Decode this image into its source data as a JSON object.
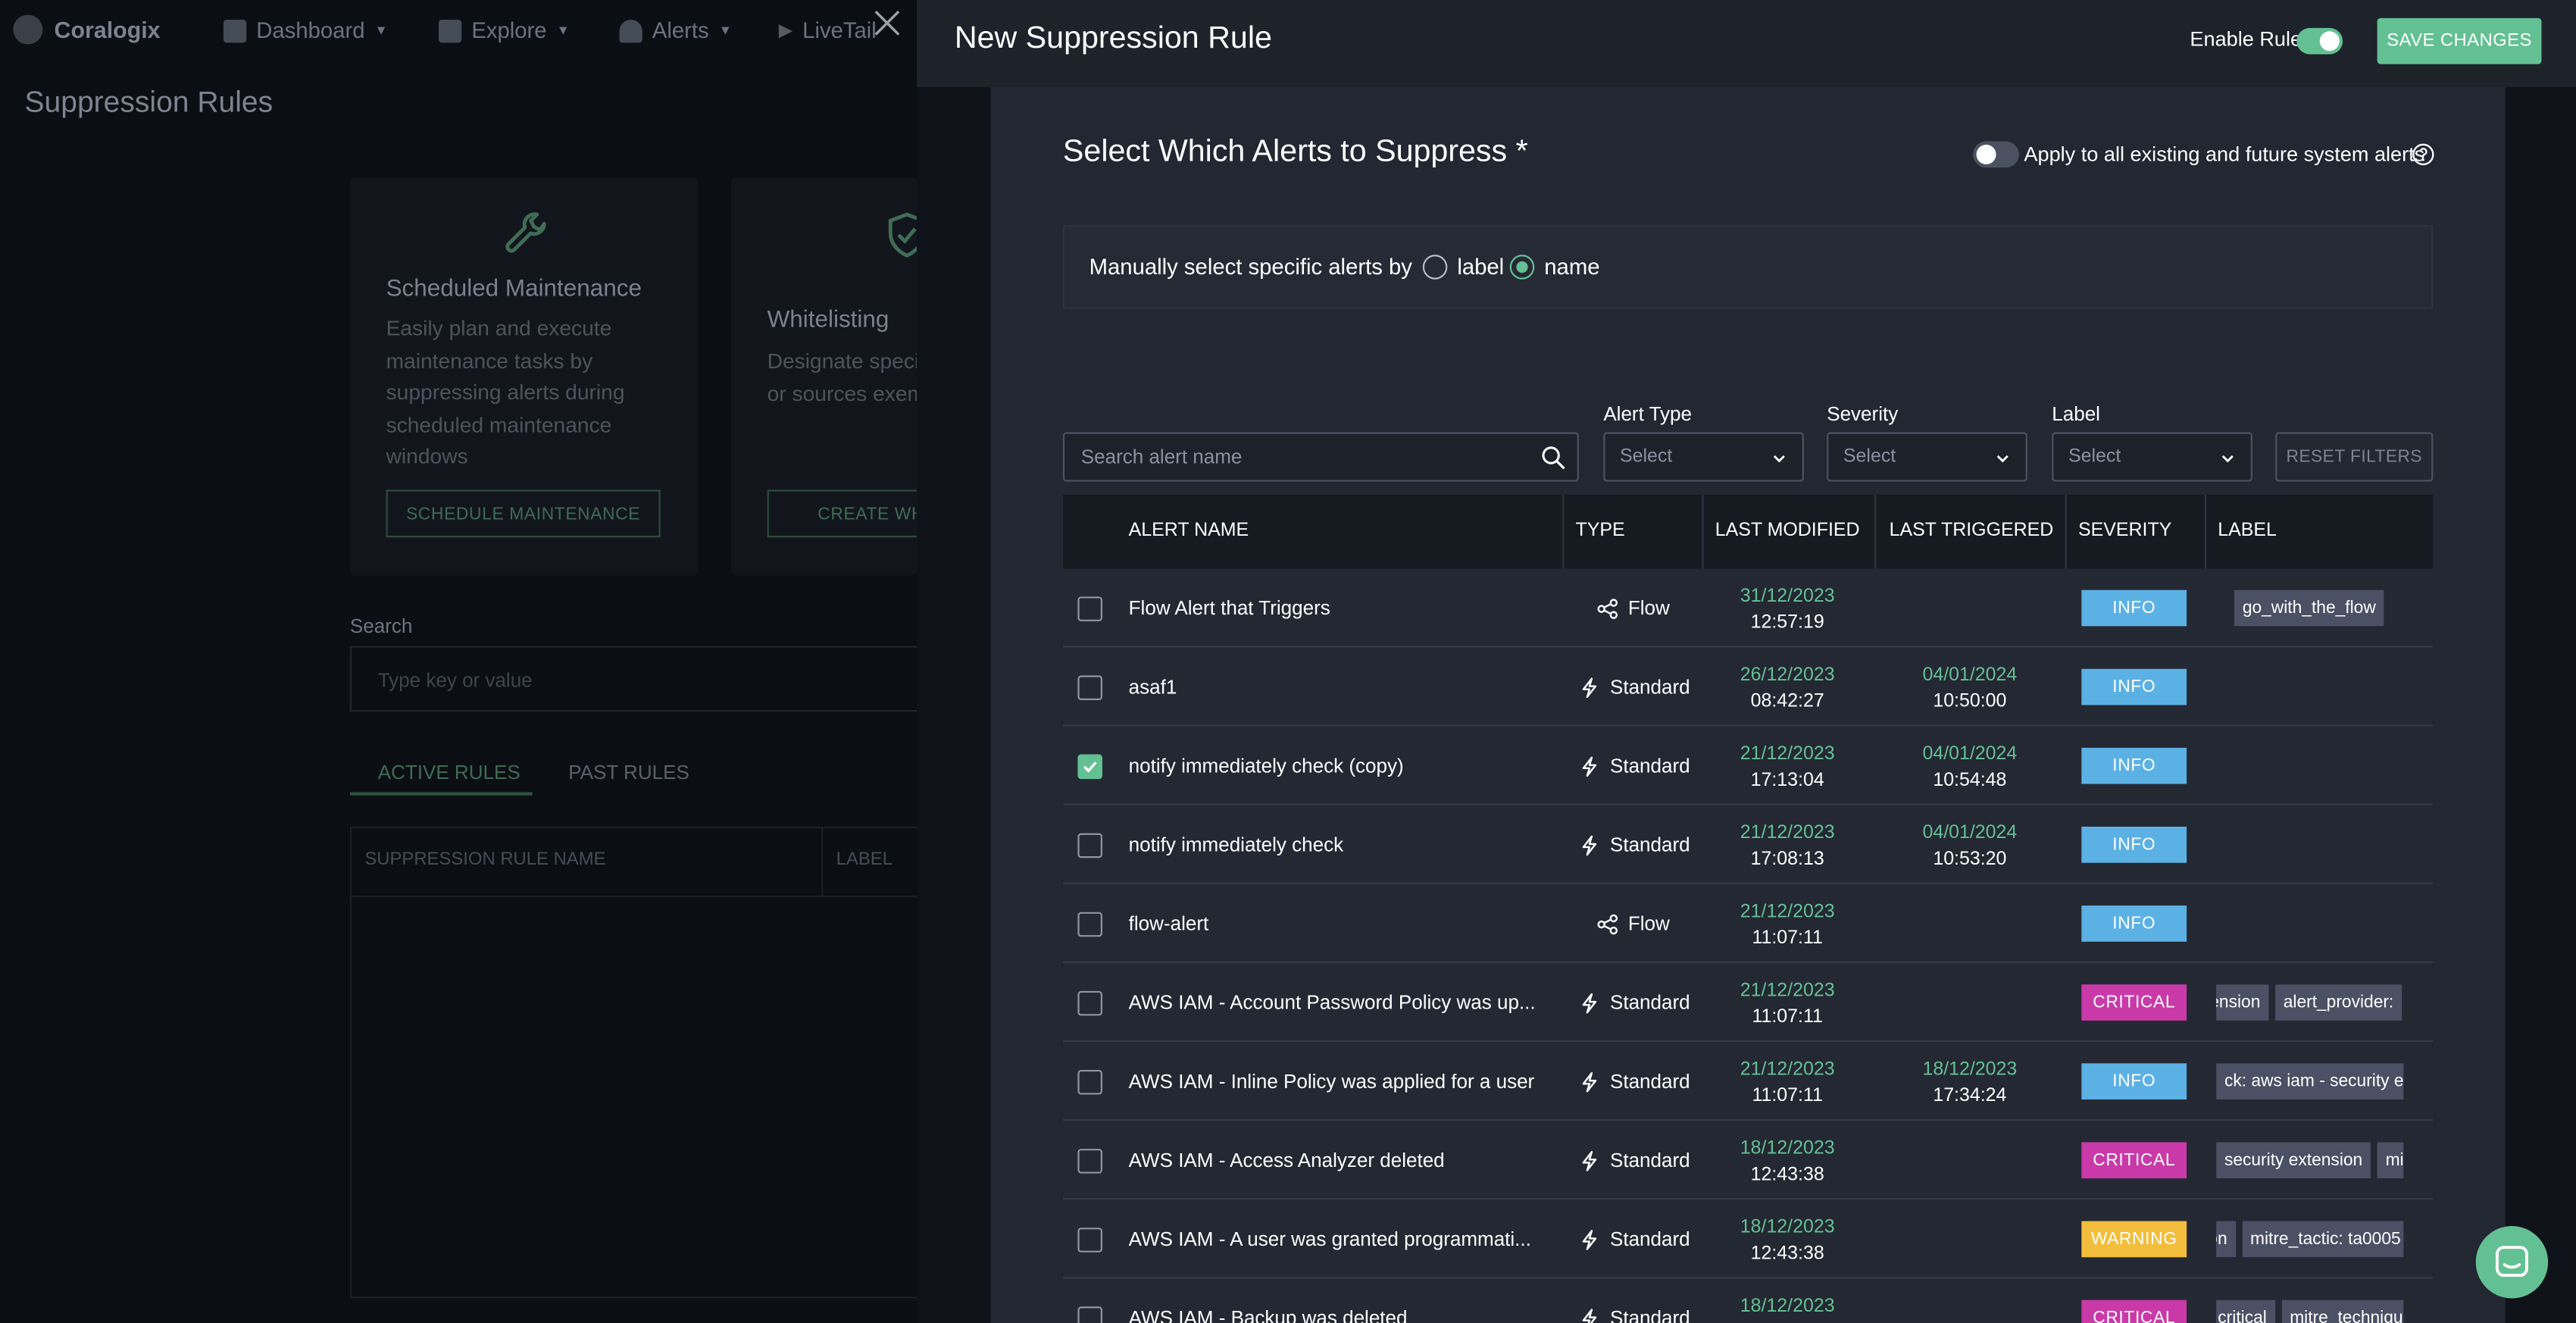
{
  "background": {
    "logo": "Coralogix",
    "nav": [
      "Dashboard",
      "Explore",
      "Alerts",
      "LiveTail"
    ],
    "page_title": "Suppression Rules",
    "cards": [
      {
        "title": "Scheduled Maintenance",
        "description": "Easily plan and execute maintenance tasks by suppressing alerts during scheduled maintenance windows",
        "button": "SCHEDULE MAINTENANCE"
      },
      {
        "title": "Whitelisting",
        "description": "Designate specific conditions or sources exempt from alerts",
        "button": "CREATE WHITELIST"
      }
    ],
    "search_label": "Search",
    "search_placeholder": "Type key or value",
    "tabs": [
      "ACTIVE RULES",
      "PAST RULES"
    ],
    "table_headers": [
      "SUPPRESSION RULE NAME",
      "LABEL"
    ]
  },
  "drawer": {
    "title": "New Suppression Rule",
    "enable_label": "Enable Rule",
    "enable_on": true,
    "save_label": "SAVE CHANGES"
  },
  "selector": {
    "title": "Select Which Alerts to Suppress *",
    "apply_label": "Apply to all existing and future system alerts",
    "apply_on": false,
    "manual_label": "Manually select specific alerts by",
    "radio_label": "label",
    "radio_name": "name",
    "selected": "name"
  },
  "filters": {
    "search_placeholder": "Search alert name",
    "alert_type_label": "Alert Type",
    "severity_label": "Severity",
    "label_label": "Label",
    "select_placeholder": "Select",
    "reset_label": "RESET FILTERS"
  },
  "table": {
    "headers": {
      "name": "ALERT NAME",
      "type": "TYPE",
      "last_modified": "LAST MODIFIED",
      "last_triggered": "LAST TRIGGERED",
      "severity": "SEVERITY",
      "label": "LABEL"
    },
    "rows": [
      {
        "checked": false,
        "name": "Flow Alert that Triggers",
        "type": "Flow",
        "mod_date": "31/12/2023",
        "mod_time": "12:57:19",
        "trig_date": "",
        "trig_time": "",
        "severity": "INFO",
        "labels": [
          "go_with_the_flow"
        ]
      },
      {
        "checked": false,
        "name": "asaf1",
        "type": "Standard",
        "mod_date": "26/12/2023",
        "mod_time": "08:42:27",
        "trig_date": "04/01/2024",
        "trig_time": "10:50:00",
        "severity": "INFO",
        "labels": []
      },
      {
        "checked": true,
        "name": "notify immediately check (copy)",
        "type": "Standard",
        "mod_date": "21/12/2023",
        "mod_time": "17:13:04",
        "trig_date": "04/01/2024",
        "trig_time": "10:54:48",
        "severity": "INFO",
        "labels": []
      },
      {
        "checked": false,
        "name": "notify immediately check",
        "type": "Standard",
        "mod_date": "21/12/2023",
        "mod_time": "17:08:13",
        "trig_date": "04/01/2024",
        "trig_time": "10:53:20",
        "severity": "INFO",
        "labels": []
      },
      {
        "checked": false,
        "name": "flow-alert",
        "type": "Flow",
        "mod_date": "21/12/2023",
        "mod_time": "11:07:11",
        "trig_date": "",
        "trig_time": "",
        "severity": "INFO",
        "labels": []
      },
      {
        "checked": false,
        "name": "AWS IAM - Account Password Policy was up...",
        "type": "Standard",
        "mod_date": "21/12/2023",
        "mod_time": "11:07:11",
        "trig_date": "",
        "trig_time": "",
        "severity": "CRITICAL",
        "labels": [
          "tension",
          "alert_provider:"
        ]
      },
      {
        "checked": false,
        "name": "AWS IAM - Inline Policy was applied for a user",
        "type": "Standard",
        "mod_date": "21/12/2023",
        "mod_time": "11:07:11",
        "trig_date": "18/12/2023",
        "trig_time": "17:34:24",
        "severity": "INFO",
        "labels": [
          "ck: aws iam - security ex"
        ]
      },
      {
        "checked": false,
        "name": "AWS IAM - Access Analyzer deleted",
        "type": "Standard",
        "mod_date": "18/12/2023",
        "mod_time": "12:43:38",
        "trig_date": "",
        "trig_time": "",
        "severity": "CRITICAL",
        "labels": [
          "security extension",
          "mit"
        ]
      },
      {
        "checked": false,
        "name": "AWS IAM - A user was granted programmati...",
        "type": "Standard",
        "mod_date": "18/12/2023",
        "mod_time": "12:43:38",
        "trig_date": "",
        "trig_time": "",
        "severity": "WARNING",
        "labels": [
          "on",
          "mitre_tactic: ta0005"
        ]
      },
      {
        "checked": false,
        "name": "AWS IAM - Backup was deleted",
        "type": "Standard",
        "mod_date": "18/12/2023",
        "mod_time": "",
        "trig_date": "",
        "trig_time": "",
        "severity": "CRITICAL",
        "labels": [
          "critical",
          "mitre_techniqu"
        ]
      }
    ]
  },
  "colors": {
    "accent": "#63c093",
    "info": "#5cb1e4",
    "critical": "#c93aa8",
    "warning": "#f2be3b"
  }
}
